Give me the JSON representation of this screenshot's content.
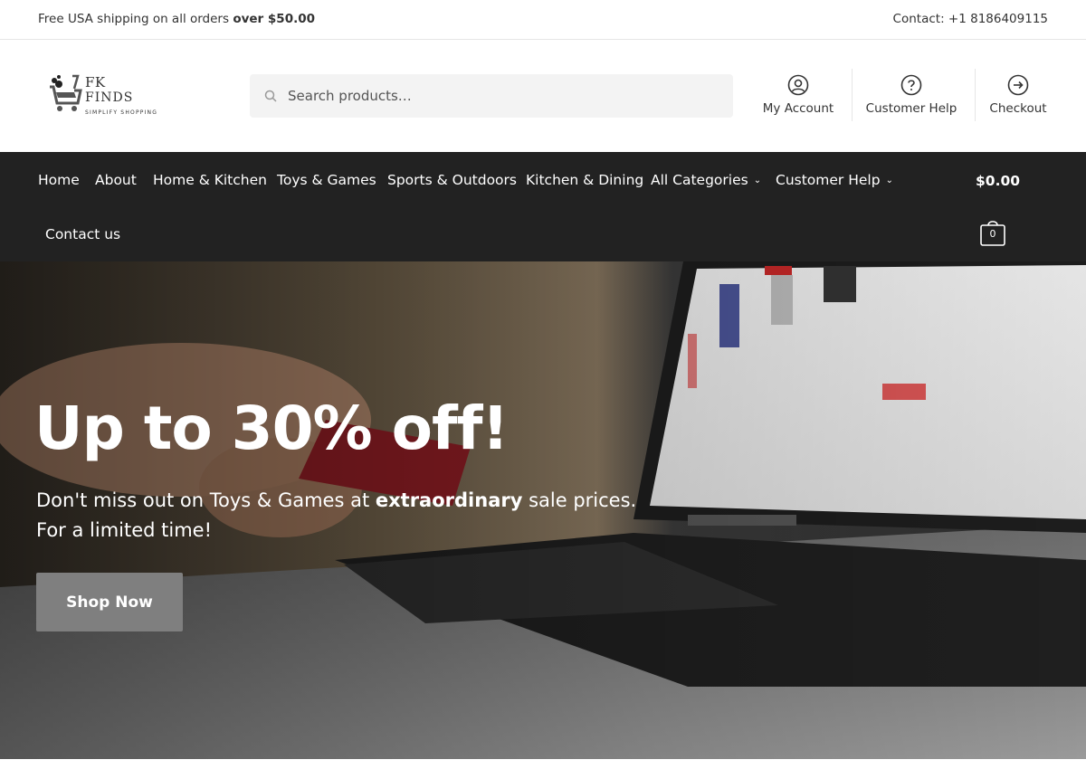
{
  "topbar": {
    "shipping_prefix": "Free USA shipping on all orders ",
    "shipping_bold": "over $50.00",
    "contact": "Contact: +1 8186409115"
  },
  "logo": {
    "line1": "FK",
    "line2": "FINDS",
    "tagline": "SIMPLIFY SHOPPING"
  },
  "search": {
    "placeholder": "Search products…",
    "icon": "search-icon"
  },
  "header_links": [
    {
      "label": "My Account",
      "icon": "user-icon"
    },
    {
      "label": "Customer Help",
      "icon": "question-icon"
    },
    {
      "label": "Checkout",
      "icon": "arrow-right-circle-icon"
    }
  ],
  "nav": {
    "items": [
      {
        "label": "Home"
      },
      {
        "label": "About"
      },
      {
        "label": "Home & Kitchen"
      },
      {
        "label": "Toys & Games"
      },
      {
        "label": "Sports & Outdoors"
      },
      {
        "label": "Kitchen & Dining"
      },
      {
        "label": "All Categories"
      },
      {
        "label": "Customer Help"
      },
      {
        "label": "Contact us"
      }
    ],
    "cart_total": "$0.00",
    "cart_count": "0"
  },
  "hero": {
    "heading": "Up to 30% off!",
    "sub_prefix": "Don't miss out on Toys & Games at ",
    "sub_bold": "extraordinary",
    "sub_suffix": " sale prices. For a limited time!",
    "button": "Shop Now"
  },
  "colors": {
    "nav_bg": "#222222",
    "button_bg": "#7f7f7f",
    "search_bg": "#f3f3f3"
  }
}
